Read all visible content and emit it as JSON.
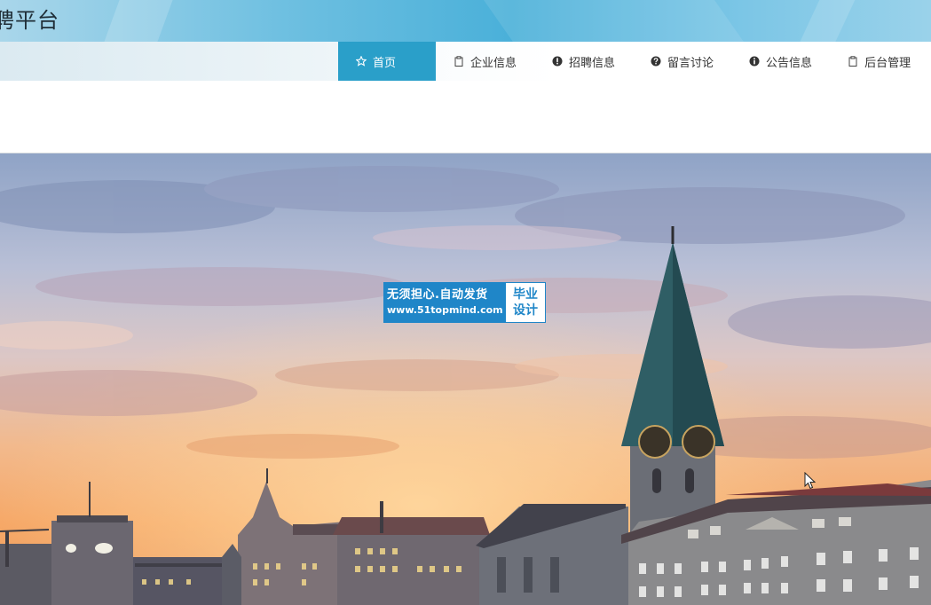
{
  "header": {
    "site_title": "聘平台"
  },
  "nav": {
    "items": [
      {
        "label": "首页",
        "icon": "star-icon",
        "active": true
      },
      {
        "label": "企业信息",
        "icon": "clipboard-icon",
        "active": false
      },
      {
        "label": "招聘信息",
        "icon": "info-circle-icon",
        "active": false
      },
      {
        "label": "留言讨论",
        "icon": "question-circle-icon",
        "active": false
      },
      {
        "label": "公告信息",
        "icon": "info-circle-icon",
        "active": false
      },
      {
        "label": "后台管理",
        "icon": "clipboard-icon",
        "active": false
      }
    ],
    "active_color": "#2a9fc9"
  },
  "watermark": {
    "line1": "无须担心.自动发货",
    "line2": "www.51topmind.com",
    "badge_line1": "毕业",
    "badge_line2": "设计",
    "color": "#1f86c8"
  },
  "hero": {
    "description_icon": "city-skyline-sunset-banner"
  }
}
